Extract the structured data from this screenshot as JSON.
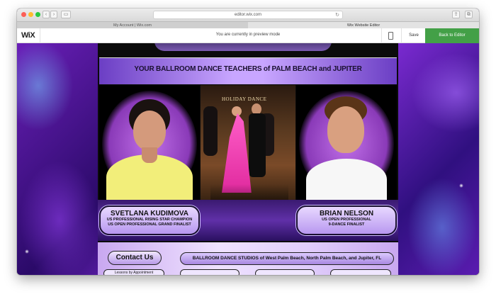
{
  "browser": {
    "address": "editor.wix.com",
    "tabs": [
      {
        "label": "My Account | Wix.com",
        "active": false
      },
      {
        "label": "Wix Website Editor",
        "active": true
      }
    ]
  },
  "wix_bar": {
    "logo": "WiX",
    "preview_message": "You are currently in preview mode",
    "save_label": "Save",
    "back_label": "Back to Editor",
    "accent_color": "#43a047"
  },
  "site": {
    "heading": "YOUR BALLROOM DANCE TEACHERS of PALM BEACH and JUPITER",
    "photo_sign": "HOLIDAY DANCE",
    "teachers": [
      {
        "name": "SVETLANA KUDIMOVA",
        "line1": "US PROFESSIONAL RISING STAR CHAMPION",
        "line2": "US OPEN PROFESSIONAL GRAND FINALIST"
      },
      {
        "name": "BRIAN NELSON",
        "line1": "US OPEN PROFESSIONAL",
        "line2": "9-DANCE FINALIST"
      }
    ],
    "contact_label": "Contact Us",
    "studios_text": "BALLROOM DANCE STUDIOS of West Palm Beach, North Palm Beach, and Jupiter, FL",
    "mini_label": "Lessons by Appointment"
  }
}
